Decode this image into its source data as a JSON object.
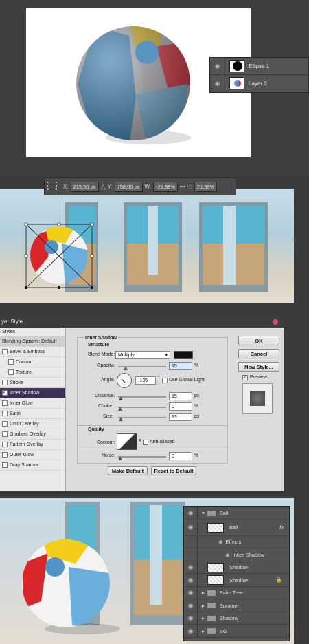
{
  "layers_panel_1": {
    "rows": [
      {
        "label": "Ellipse 1"
      },
      {
        "label": "Layer 0"
      }
    ]
  },
  "transform_bar": {
    "x_label": "X:",
    "x_value": "215,50 px",
    "y_label": "Y:",
    "y_value": "758,00 px",
    "w_label": "W:",
    "w_value": "-21,98%",
    "h_label": "H:",
    "h_value": "21,99%"
  },
  "layer_style": {
    "title": "yer Style",
    "styles_header": "Styles",
    "blending_options": "Blending Options: Default",
    "items": [
      "Bevel & Emboss",
      "Contour",
      "Texture",
      "Stroke",
      "Inner Shadow",
      "Inner Glow",
      "Satin",
      "Color Overlay",
      "Gradient Overlay",
      "Pattern Overlay",
      "Outer Glow",
      "Drop Shadow"
    ],
    "section_title": "Inner Shadow",
    "structure_title": "Structure",
    "blend_mode_label": "Blend Mode:",
    "blend_mode_value": "Multiply",
    "opacity_label": "Opacity:",
    "opacity_value": "15",
    "angle_label": "Angle:",
    "angle_value": "-135",
    "degree_symbol": "°",
    "global_light_label": "Use Global Light",
    "distance_label": "Distance:",
    "distance_value": "15",
    "choke_label": "Choke:",
    "choke_value": "0",
    "size_label": "Size:",
    "size_value": "13",
    "quality_title": "Quality",
    "contour_label": "Contour:",
    "anti_aliased_label": "Anti-aliased",
    "noise_label": "Noise:",
    "noise_value": "0",
    "unit_pct": "%",
    "unit_px": "px",
    "make_default": "Make Default",
    "reset_default": "Reset to Default",
    "ok": "OK",
    "cancel": "Cancel",
    "new_style": "New Style...",
    "preview": "Preview",
    "opacity_level": 0.15,
    "distance_level": 0.05,
    "size_level": 0.05
  },
  "layers_panel_2": {
    "rows": [
      {
        "label": "Ball",
        "type": "group-open"
      },
      {
        "label": "Ball",
        "type": "smart",
        "fx": "fx"
      },
      {
        "label": "Effects",
        "type": "effects"
      },
      {
        "label": "Inner Shadow",
        "type": "effect"
      },
      {
        "label": "Shadow",
        "type": "layer"
      },
      {
        "label": "Shadow",
        "type": "layer-locked"
      },
      {
        "label": "Palm Tree",
        "type": "group"
      },
      {
        "label": "Summer",
        "type": "group"
      },
      {
        "label": "Shadow",
        "type": "group"
      },
      {
        "label": "BG",
        "type": "group"
      }
    ]
  },
  "colors": {
    "panel": "#535353",
    "selected": "#3e3157",
    "ball_blue": "#4f93c7",
    "ball_red": "#d8262a",
    "ball_yellow": "#f2cd1a"
  }
}
